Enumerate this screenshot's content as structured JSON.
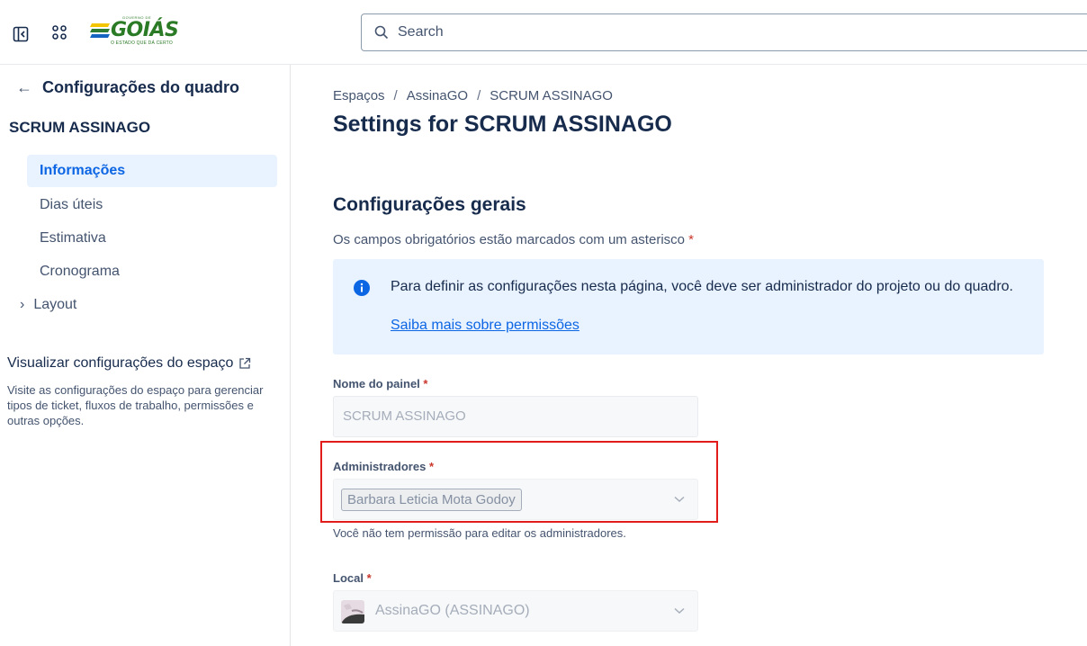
{
  "topbar": {
    "logo_text": "GOIÁS",
    "logo_top": "GOVERNO DE",
    "logo_tagline": "O ESTADO QUE DÁ CERTO",
    "search_placeholder": "Search"
  },
  "sidebar": {
    "back_title": "Configurações do quadro",
    "board_name": "SCRUM ASSINAGO",
    "items": [
      {
        "label": "Informações",
        "active": true
      },
      {
        "label": "Dias úteis"
      },
      {
        "label": "Estimativa"
      },
      {
        "label": "Cronograma"
      },
      {
        "label": "Layout",
        "expandable": true
      }
    ],
    "space_link": "Visualizar configurações do espaço",
    "space_desc": "Visite as configurações do espaço para gerenciar tipos de ticket, fluxos de trabalho, permissões e outras opções."
  },
  "main": {
    "breadcrumb": [
      "Espaços",
      "AssinaGO",
      "SCRUM ASSINAGO"
    ],
    "breadcrumb_sep": "/",
    "page_title": "Settings for SCRUM ASSINAGO",
    "section_title": "Configurações gerais",
    "required_note": "Os campos obrigatórios estão marcados com um asterisco",
    "asterisk": "*",
    "info": {
      "message": "Para definir as configurações nesta página, você deve ser administrador do projeto ou do quadro.",
      "link": "Saiba mais sobre permissões"
    },
    "board_name_field": {
      "label": "Nome do painel",
      "value": "SCRUM ASSINAGO"
    },
    "admins_field": {
      "label": "Administradores",
      "selected": "Barbara Leticia Mota Godoy",
      "helper": "Você não tem permissão para editar os administradores."
    },
    "location_field": {
      "label": "Local",
      "value": "AssinaGO (ASSINAGO)"
    }
  },
  "colors": {
    "accent": "#0c66e4",
    "info_bg": "#e9f2ff",
    "required": "#c9372c",
    "highlight": "#e21b1b"
  }
}
